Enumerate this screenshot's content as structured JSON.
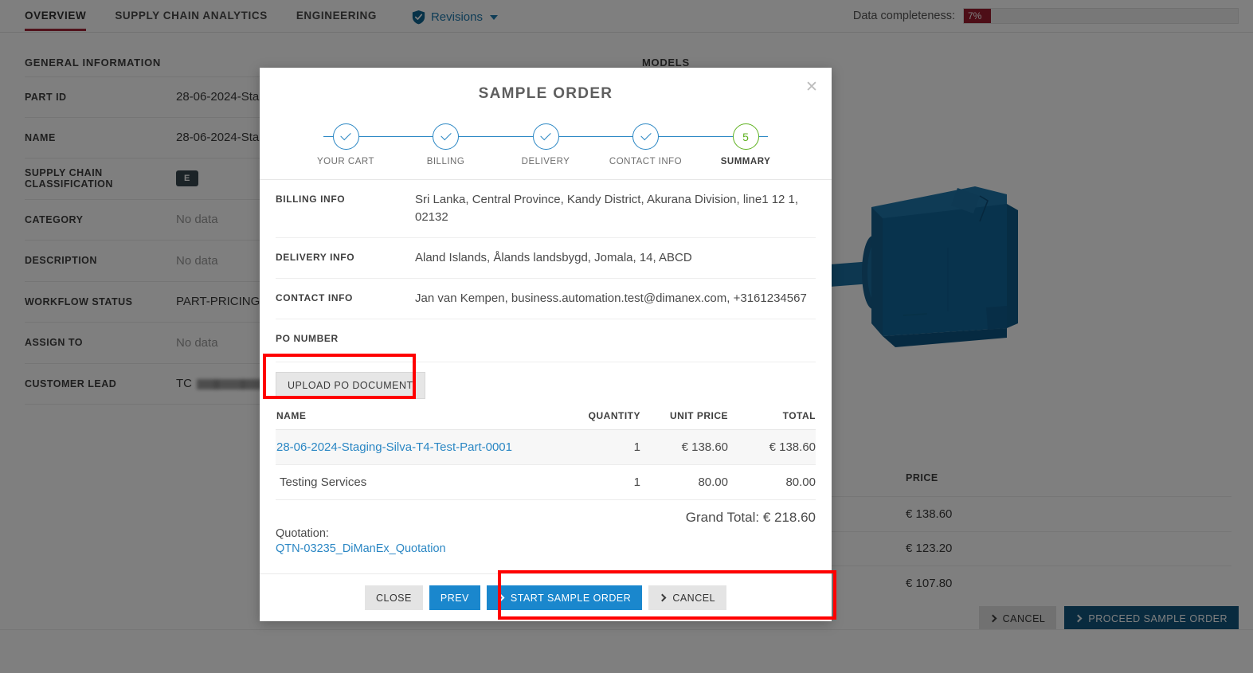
{
  "tabs": [
    {
      "label": "OVERVIEW",
      "active": true
    },
    {
      "label": "SUPPLY CHAIN ANALYTICS",
      "active": false
    },
    {
      "label": "ENGINEERING",
      "active": false
    }
  ],
  "revisions": {
    "label": "Revisions",
    "icon": "shield-check-icon"
  },
  "completeness": {
    "label": "Data completeness:",
    "value": "7%",
    "percent": 7,
    "color": "#9b1c2e"
  },
  "general": {
    "title": "GENERAL INFORMATION",
    "rows": [
      {
        "key": "PART ID",
        "value": "28-06-2024-Sta"
      },
      {
        "key": "NAME",
        "value": "28-06-2024-Sta"
      },
      {
        "key": "SUPPLY CHAIN CLASSIFICATION",
        "value": "E",
        "type": "chip"
      },
      {
        "key": "CATEGORY",
        "value": "No data",
        "empty": true
      },
      {
        "key": "DESCRIPTION",
        "value": "No data",
        "empty": true
      },
      {
        "key": "WORKFLOW STATUS",
        "value": "PART-PRICING-I"
      },
      {
        "key": "ASSIGN TO",
        "value": "No data",
        "empty": true
      },
      {
        "key": "CUSTOMER LEAD",
        "value": "TC",
        "redacted": true
      }
    ]
  },
  "models": {
    "title": "MODELS",
    "price_header": "PRICE",
    "prices": [
      "€ 138.60",
      "€ 123.20",
      "€ 107.80"
    ]
  },
  "page_actions": [
    {
      "label": "CANCEL",
      "style": "grey",
      "icon": "chevron-right-icon"
    },
    {
      "label": "PROCEED SAMPLE ORDER",
      "style": "darkblue",
      "icon": "chevron-right-icon"
    }
  ],
  "modal": {
    "title": "SAMPLE ORDER",
    "close_icon": "close-icon",
    "steps": [
      {
        "label": "YOUR CART",
        "state": "done",
        "marker": "check"
      },
      {
        "label": "BILLING",
        "state": "done",
        "marker": "check"
      },
      {
        "label": "DELIVERY",
        "state": "done",
        "marker": "check"
      },
      {
        "label": "CONTACT INFO",
        "state": "done",
        "marker": "check"
      },
      {
        "label": "SUMMARY",
        "state": "current",
        "marker": "5"
      }
    ],
    "info": [
      {
        "key": "BILLING INFO",
        "value": "Sri Lanka, Central Province, Kandy District, Akurana Division, line1 12 1, 02132"
      },
      {
        "key": "DELIVERY INFO",
        "value": "Aland Islands, Ålands landsbygd, Jomala, 14, ABCD"
      },
      {
        "key": "CONTACT INFO",
        "value": "Jan van Kempen, business.automation.test@dimanex.com, +3161234567"
      },
      {
        "key": "PO NUMBER",
        "value": ""
      }
    ],
    "upload_label": "UPLOAD PO DOCUMENT",
    "cart": {
      "headers": [
        "NAME",
        "QUANTITY",
        "UNIT PRICE",
        "TOTAL"
      ],
      "rows": [
        {
          "name": "28-06-2024-Staging-Silva-T4-Test-Part-0001",
          "quantity": "1",
          "unit_price": "€ 138.60",
          "total": "€ 138.60",
          "link": true,
          "highlight": true
        },
        {
          "name": "Testing Services",
          "quantity": "1",
          "unit_price": "80.00",
          "total": "80.00",
          "link": false,
          "highlight": false
        }
      ],
      "grand_total": "Grand Total: € 218.60"
    },
    "quotation_label": "Quotation:",
    "quotation_link": "QTN-03235_DiManEx_Quotation",
    "footer_buttons": [
      {
        "label": "CLOSE",
        "style": "lightgrey",
        "icon": null
      },
      {
        "label": "PREV",
        "style": "blue",
        "icon": null
      },
      {
        "label": "START SAMPLE ORDER",
        "style": "blue",
        "icon": "chevron-right-icon"
      },
      {
        "label": "CANCEL",
        "style": "lightgrey",
        "icon": "chevron-right-icon"
      }
    ]
  },
  "annotations": {
    "upload_box": "highlight-upload-po-document",
    "footer_box": "highlight-modal-footer-buttons",
    "color": "#ff0000"
  }
}
